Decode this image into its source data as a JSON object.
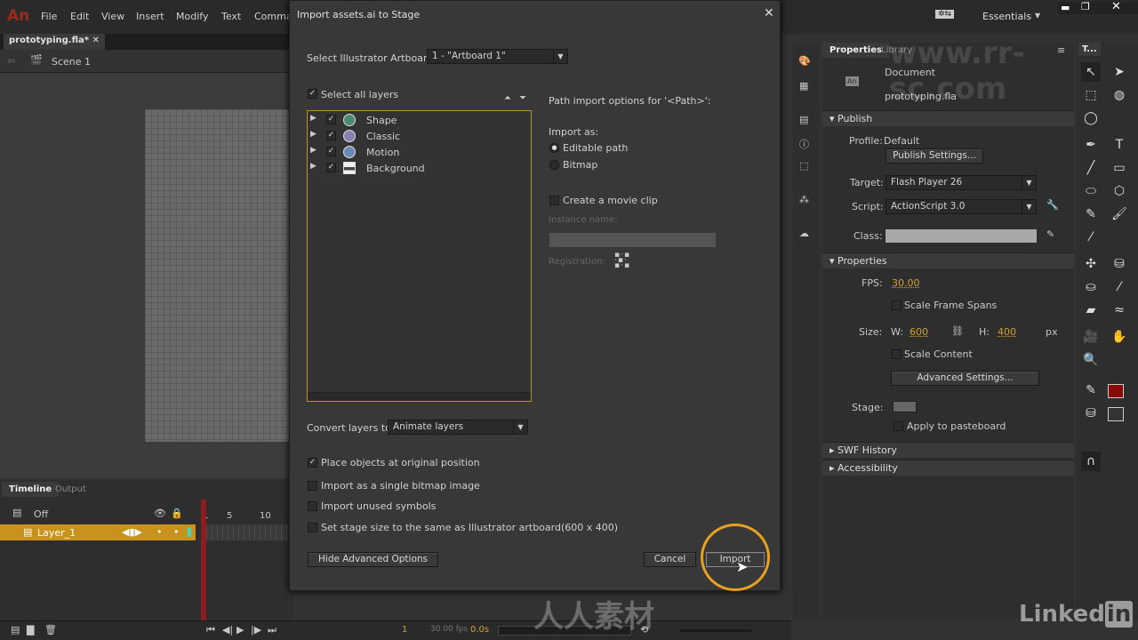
{
  "app": {
    "logo": "An",
    "menus": [
      "File",
      "Edit",
      "View",
      "Insert",
      "Modify",
      "Text",
      "Comma"
    ],
    "workspace": "Essentials",
    "doc_tab": "prototyping.fla*",
    "scene": "Scene 1"
  },
  "timeline": {
    "tabs": [
      "Timeline",
      "Output"
    ],
    "onion_label": "Off",
    "layer": "Layer_1",
    "frame_ticks": [
      "1",
      "5",
      "10"
    ],
    "current_frame": "1",
    "fps": "30.00 fps",
    "time": "0.0s"
  },
  "dialog": {
    "title": "Import assets.ai to Stage",
    "artboard_label": "Select Illustrator Artboard:",
    "artboard_value": "1 - \"Artboard 1\"",
    "select_all": "Select all layers",
    "layers": [
      {
        "name": "Shape",
        "color": "#4a8a70",
        "checked": true
      },
      {
        "name": "Classic",
        "color": "#8a80b0",
        "checked": true
      },
      {
        "name": "Motion",
        "color": "#6a8ab8",
        "checked": true
      },
      {
        "name": "Background",
        "color": "#444",
        "checked": true
      }
    ],
    "path_options": "Path import options for '<Path>':",
    "import_as": "Import as:",
    "radio": [
      {
        "label": "Editable path",
        "checked": true
      },
      {
        "label": "Bitmap",
        "checked": false
      }
    ],
    "movie_clip": "Create a movie clip",
    "instance_name": "Instance name:",
    "registration": "Registration:",
    "convert_label": "Convert layers to:",
    "convert_value": "Animate layers",
    "options": [
      {
        "label": "Place objects at original position",
        "checked": true
      },
      {
        "label": "Import as a single bitmap image",
        "checked": false
      },
      {
        "label": "Import unused symbols",
        "checked": false
      },
      {
        "label": "Set stage size to the same as Illustrator artboard(600 x 400)",
        "checked": false
      }
    ],
    "hide_advanced": "Hide Advanced Options",
    "cancel": "Cancel",
    "import": "Import"
  },
  "props": {
    "tabs": [
      "Properties",
      "Library"
    ],
    "doc_type": "Document",
    "doc_name": "prototyping.fla",
    "publish": "Publish",
    "profile_label": "Profile:",
    "profile": "Default",
    "publish_settings": "Publish Settings...",
    "target_label": "Target:",
    "target": "Flash Player 26",
    "script_label": "Script:",
    "script": "ActionScript 3.0",
    "class_label": "Class:",
    "properties": "Properties",
    "fps_label": "FPS:",
    "fps": "30.00",
    "scale_spans": "Scale Frame Spans",
    "size_label": "Size:",
    "w_label": "W:",
    "w": "600",
    "h_label": "H:",
    "h": "400",
    "px": "px",
    "scale_content": "Scale Content",
    "advanced": "Advanced Settings...",
    "stage_label": "Stage:",
    "apply_pasteboard": "Apply to pasteboard",
    "swf_history": "SWF History",
    "accessibility": "Accessibility",
    "tools_tab": "T..."
  },
  "watermarks": {
    "site": "www.rr-sc.com",
    "brand": "人人素材",
    "linkedin": "Linked in"
  }
}
